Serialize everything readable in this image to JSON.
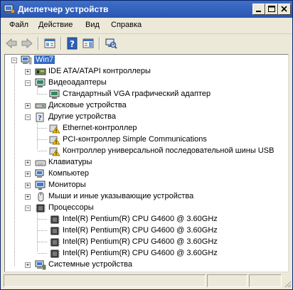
{
  "window": {
    "title": "Диспетчер устройств"
  },
  "menu": {
    "file": "Файл",
    "action": "Действие",
    "view": "Вид",
    "help": "Справка"
  },
  "tree": {
    "root": "Win7",
    "ide": "IDE ATA/ATAPI контроллеры",
    "video": "Видеоадаптеры",
    "video_child": "Стандартный VGA графический адаптер",
    "disks": "Дисковые устройства",
    "other": "Другие устройства",
    "other_children": [
      "Ethernet-контроллер",
      "PCI-контроллер Simple Communications",
      "Контроллер универсальной последовательной шины USB"
    ],
    "keyboards": "Клавиатуры",
    "computer": "Компьютер",
    "monitors": "Мониторы",
    "mice": "Мыши и иные указывающие устройства",
    "processors": "Процессоры",
    "cpu_children": [
      "Intel(R) Pentium(R) CPU G4600 @ 3.60GHz",
      "Intel(R) Pentium(R) CPU G4600 @ 3.60GHz",
      "Intel(R) Pentium(R) CPU G4600 @ 3.60GHz",
      "Intel(R) Pentium(R) CPU G4600 @ 3.60GHz"
    ],
    "system": "Системные устройства"
  }
}
